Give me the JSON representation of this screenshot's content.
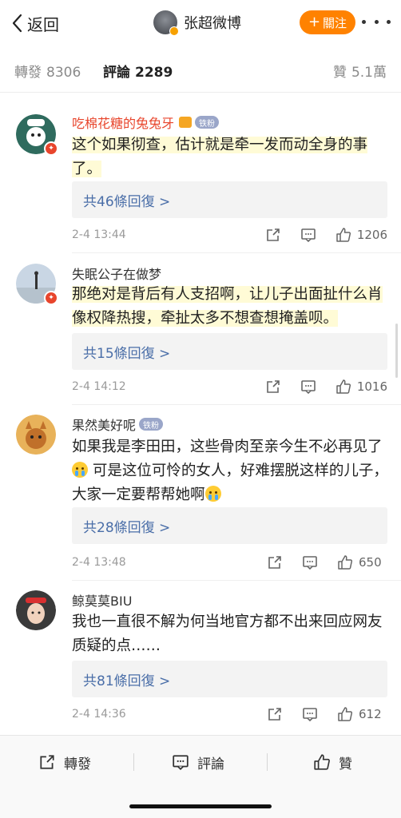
{
  "nav": {
    "back_label": "返回",
    "title": "张超微博",
    "follow_label": "關注",
    "follow_plus": "+"
  },
  "tabs": {
    "repost": {
      "label": "轉發",
      "count": "8306"
    },
    "comment": {
      "label": "評論",
      "count": "2289"
    },
    "like": {
      "label": "贊",
      "count": "5.1萬"
    }
  },
  "comments": [
    {
      "user": "吃棉花糖的兔兔牙",
      "badge": "铁粉",
      "text": "这个如果彻查，估计就是牵一发而动全身的事了。",
      "replies": "共46條回復 >",
      "time": "2-4 13:44",
      "likes": "1206"
    },
    {
      "user": "失眠公子在做梦",
      "text": "那绝对是背后有人支招啊，让儿子出面扯什么肖像权降热搜，牵扯太多不想查想掩盖呗。",
      "replies": "共15條回復 >",
      "time": "2-4 14:12",
      "likes": "1016"
    },
    {
      "user": "果然美好呢",
      "badge": "铁粉",
      "text_a": "如果我是李田田，这些骨肉至亲今生不必再见了",
      "text_b": " 可是这位可怜的女人，好难摆脱这样的儿子，大家一定要帮帮她啊",
      "replies": "共28條回復 >",
      "time": "2-4 13:48",
      "likes": "650"
    },
    {
      "user": "鲸莫莫BIU",
      "text": "我也一直很不解为何当地官方都不出来回应网友质疑的点……",
      "replies": "共81條回復 >",
      "time": "2-4 14:36",
      "likes": "612"
    }
  ],
  "bottom": {
    "repost": "轉發",
    "comment": "評論",
    "like": "贊"
  },
  "colors": {
    "accent": "#ff8200",
    "link": "#4a6ea8",
    "vip_name": "#e8452c",
    "highlight": "#fffbd6"
  }
}
